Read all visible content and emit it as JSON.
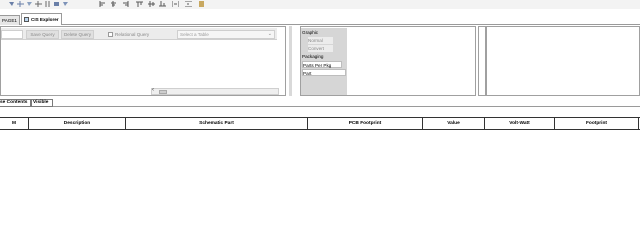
{
  "toolbar": {
    "icons": [
      "place-part-icon",
      "place-wire-icon",
      "place-net-icon",
      "place-bus-icon",
      "place-junction-icon",
      "place-power-icon",
      "place-ground-icon",
      "align-left-icon",
      "align-center-icon",
      "align-right-icon",
      "align-top-icon",
      "align-middle-icon",
      "align-bottom-icon",
      "distribute-icon",
      "part-editor-icon"
    ]
  },
  "tabs": {
    "page2": "PAGE1",
    "cis_explorer": "CIS Explorer"
  },
  "query": {
    "save_label": "Save Query",
    "delete_label": "Delete Query",
    "relational_label": "Relational Query",
    "table_placeholder": "Select a Table"
  },
  "properties": {
    "graphic_label": "Graphic",
    "normal_label": "Normal",
    "convert_label": "Convert",
    "packaging_label": "Packaging",
    "parts_per_pkg_label": "Parts Per Pkg",
    "part_label": "Part"
  },
  "lower_tabs": {
    "contents": "se Contents",
    "visible": "Visible"
  },
  "table": {
    "columns": [
      "M",
      "Description",
      "Schematic Part",
      "PCB Footprint",
      "Value",
      "Volt-Watt",
      "Footprint"
    ]
  },
  "colors": {
    "toolbar_bg": "#f3f3f3",
    "grid_bg": "#d6d6d6",
    "border": "#a0a0a0"
  }
}
